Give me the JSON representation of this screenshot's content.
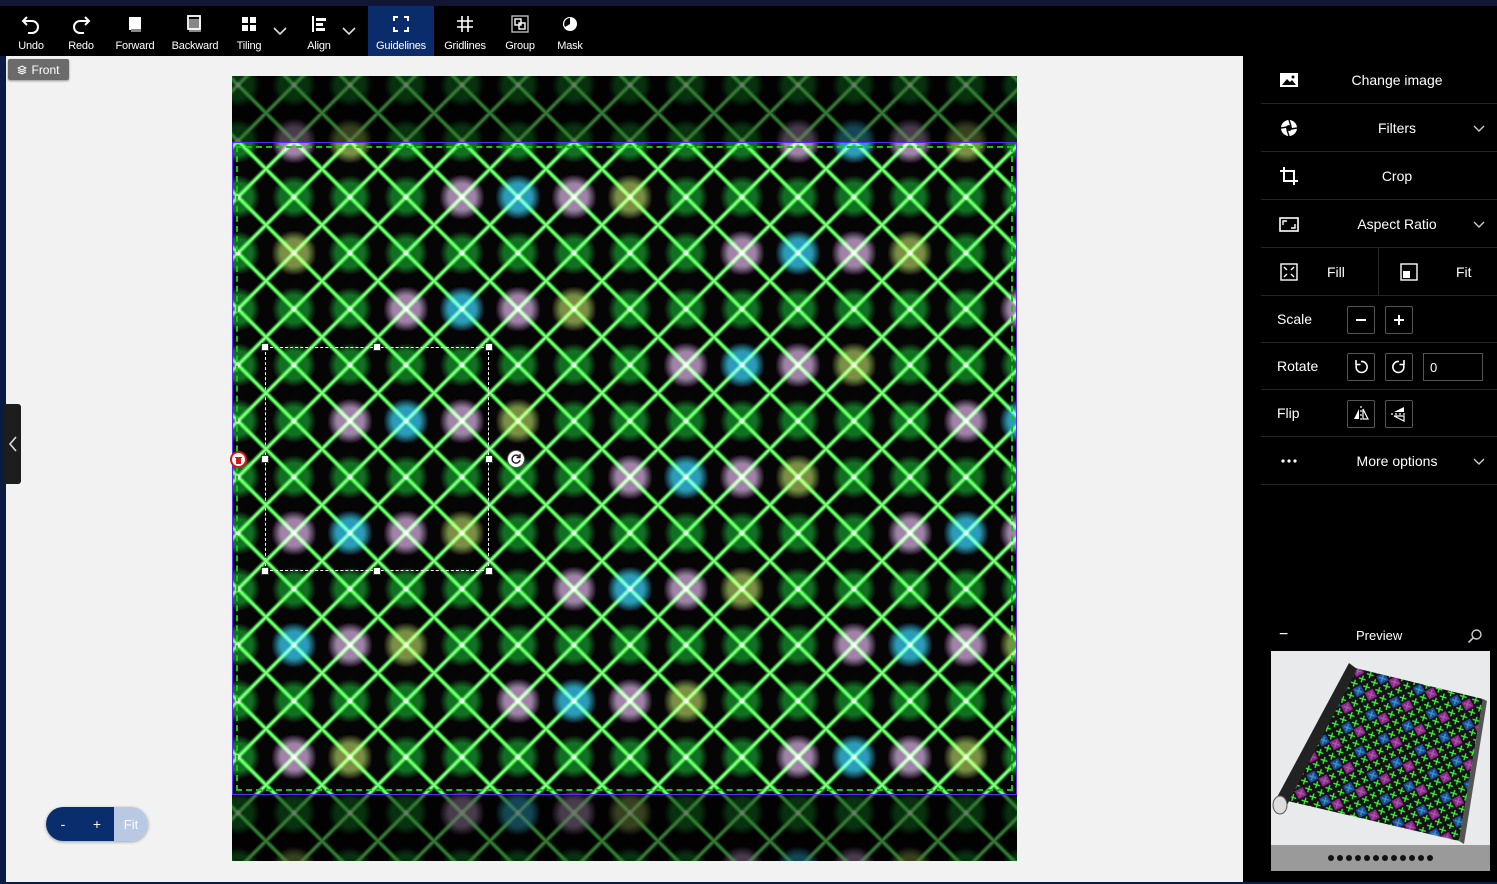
{
  "toolbar": {
    "buttons": [
      {
        "label": "Undo",
        "icon": "undo-icon"
      },
      {
        "label": "Redo",
        "icon": "redo-icon"
      },
      {
        "label": "Forward",
        "icon": "forward-icon"
      },
      {
        "label": "Backward",
        "icon": "backward-icon"
      },
      {
        "label": "Tiling",
        "icon": "tiling-icon"
      },
      {
        "label": "Align",
        "icon": "align-icon"
      },
      {
        "label": "Guidelines",
        "icon": "guidelines-icon",
        "active": true
      },
      {
        "label": "Gridlines",
        "icon": "gridlines-icon"
      },
      {
        "label": "Group",
        "icon": "group-icon"
      },
      {
        "label": "Mask",
        "icon": "mask-icon"
      }
    ]
  },
  "canvas": {
    "side_label": "Front",
    "zoom_out": "-",
    "zoom_in": "+",
    "zoom_fit": "Fit"
  },
  "panel": {
    "change_image": "Change image",
    "filters": "Filters",
    "crop": "Crop",
    "aspect_ratio": "Aspect Ratio",
    "fill": "Fill",
    "fit": "Fit",
    "scale": "Scale",
    "rotate": "Rotate",
    "rotate_value": "0",
    "flip": "Flip",
    "more_options": "More options",
    "preview_minus": "−",
    "preview": "Preview",
    "preview_dot_count": 12
  },
  "colors": {
    "accent": "#0b2c6b",
    "panel_bg": "#000000",
    "canvas_bg": "#f2f2f2",
    "guide_outer": "#5a2bff",
    "guide_inner": "#16c316",
    "delete_handle": "#d31a1a"
  }
}
